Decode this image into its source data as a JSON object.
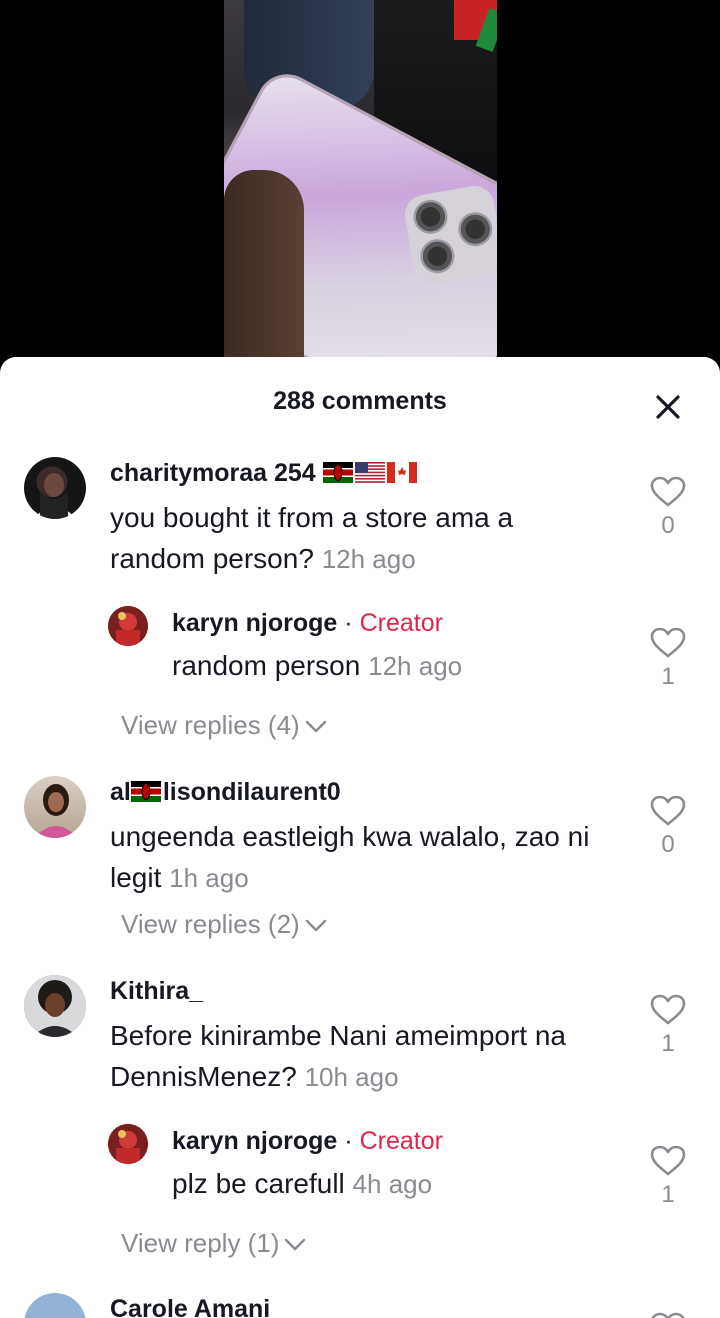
{
  "sheet": {
    "title": "288 comments"
  },
  "icons": {
    "close": "close-icon",
    "like": "heart-outline-icon",
    "chevron": "chevron-down-icon"
  },
  "colors": {
    "creator_badge": "#e1254a",
    "text_primary": "#161823",
    "text_secondary": "#8a8b91"
  },
  "comments": [
    {
      "username": "charitymoraa 254",
      "flags": [
        "kenya-flag",
        "usa-flag",
        "canada-flag"
      ],
      "text": "you bought it from a store ama a random person?",
      "time": "12h ago",
      "likes": "0",
      "reply": {
        "username": "karyn njoroge",
        "separator": "·",
        "badge": "Creator",
        "text": "random person",
        "time": "12h ago",
        "likes": "1"
      },
      "view_replies": "View replies (4)"
    },
    {
      "username_prefix": "al",
      "username_suffix": "lisondilaurent0",
      "flags": [
        "kenya-flag"
      ],
      "text": "ungeenda eastleigh kwa walalo, zao ni legit",
      "time": "1h ago",
      "likes": "0",
      "view_replies": "View replies (2)"
    },
    {
      "username": "Kithira_",
      "text": "Before kinirambe Nani ameimport na DennisMenez?",
      "time": "10h ago",
      "likes": "1",
      "reply": {
        "username": "karyn njoroge",
        "separator": "·",
        "badge": "Creator",
        "text": "plz be carefull",
        "time": "4h ago",
        "likes": "1"
      },
      "view_replies": "View reply (1)"
    },
    {
      "username": "Carole Amani"
    }
  ]
}
